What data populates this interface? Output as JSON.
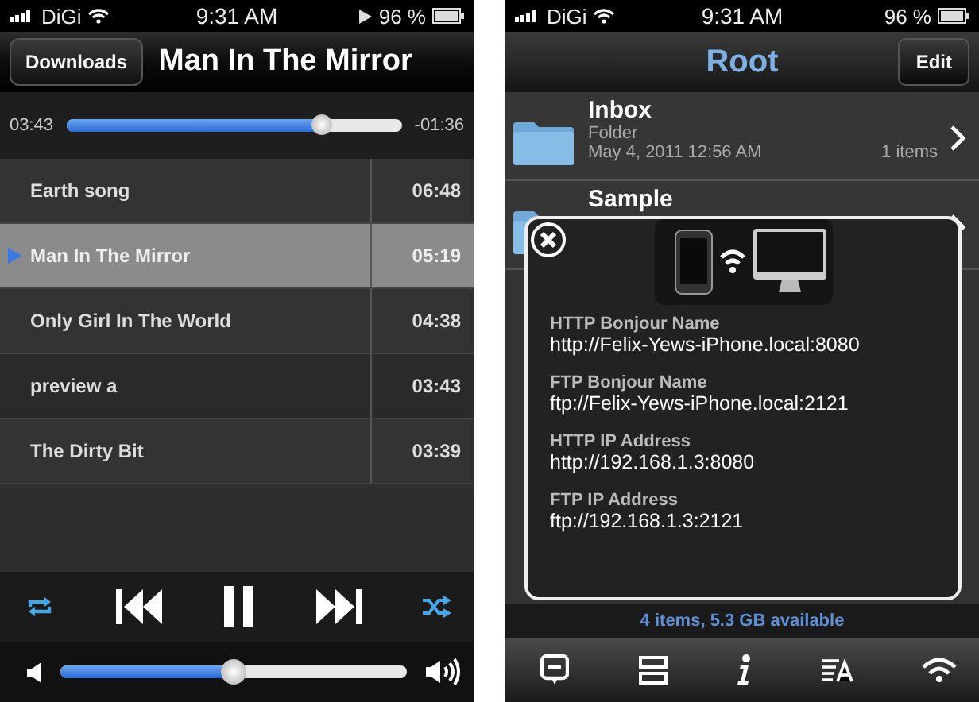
{
  "player": {
    "status_bar": {
      "carrier": "DiGi",
      "time": "9:31 AM",
      "battery": "96 %"
    },
    "nav": {
      "back": "Downloads",
      "title": "Man In The Mirror"
    },
    "progress": {
      "elapsed": "03:43",
      "remaining": "-01:36",
      "level": 0.76
    },
    "tracks": [
      {
        "title": "Earth song",
        "duration": "06:48",
        "selected": false
      },
      {
        "title": "Man In The Mirror",
        "duration": "05:19",
        "selected": true
      },
      {
        "title": "Only Girl In The World",
        "duration": "04:38",
        "selected": false
      },
      {
        "title": "preview a",
        "duration": "03:43",
        "selected": false
      },
      {
        "title": "The Dirty Bit",
        "duration": "03:39",
        "selected": false
      }
    ],
    "controls": {
      "repeat": true,
      "shuffle": true
    },
    "volume": {
      "level": 0.5
    }
  },
  "browser": {
    "status_bar": {
      "carrier": "DiGi",
      "time": "9:31 AM",
      "battery": "96 %"
    },
    "nav": {
      "title": "Root",
      "edit": "Edit"
    },
    "rows": [
      {
        "name": "Inbox",
        "type": "Folder",
        "date": "May 4, 2011 12:56 AM",
        "count": "1 items"
      },
      {
        "name": "Sample"
      }
    ],
    "popup": {
      "entries": [
        {
          "label": "HTTP Bonjour Name",
          "value": "http://Felix-Yews-iPhone.local:8080"
        },
        {
          "label": "FTP Bonjour Name",
          "value": "ftp://Felix-Yews-iPhone.local:2121"
        },
        {
          "label": "HTTP IP Address",
          "value": "http://192.168.1.3:8080"
        },
        {
          "label": "FTP IP Address",
          "value": "ftp://192.168.1.3:2121"
        }
      ]
    },
    "footer": "4 items, 5.3 GB available"
  }
}
